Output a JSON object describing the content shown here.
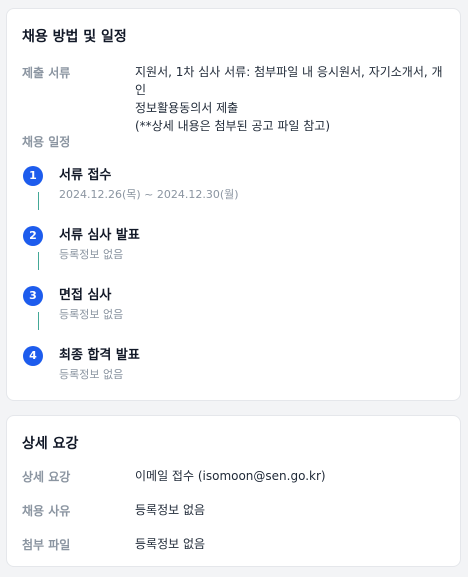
{
  "recruitment": {
    "title": "채용 방법 및 일정",
    "docs_label": "제출 서류",
    "docs_lines": [
      "지원서, 1차 심사 서류: 첨부파일 내 응시원서, 자기소개서, 개인",
      "정보활용동의서 제출",
      "(**상세 내용은 첨부된 공고 파일 참고)"
    ],
    "schedule_label": "채용 일정",
    "steps": [
      {
        "num": "1",
        "title": "서류 접수",
        "sub": "2024.12.26(목) ~ 2024.12.30(월)"
      },
      {
        "num": "2",
        "title": "서류 심사 발표",
        "sub": "등록정보 없음"
      },
      {
        "num": "3",
        "title": "면접 심사",
        "sub": "등록정보 없음"
      },
      {
        "num": "4",
        "title": "최종 합격 발표",
        "sub": "등록정보 없음"
      }
    ]
  },
  "details": {
    "title": "상세 요강",
    "rows": [
      {
        "label": "상세 요강",
        "value": "이메일 접수 (isomoon@sen.go.kr)"
      },
      {
        "label": "채용 사유",
        "value": "등록정보 없음"
      },
      {
        "label": "첨부 파일",
        "value": "등록정보 없음"
      }
    ]
  },
  "colors": {
    "accent": "#1d5ced",
    "connector": "#44a897",
    "muted": "#8b95a1"
  }
}
